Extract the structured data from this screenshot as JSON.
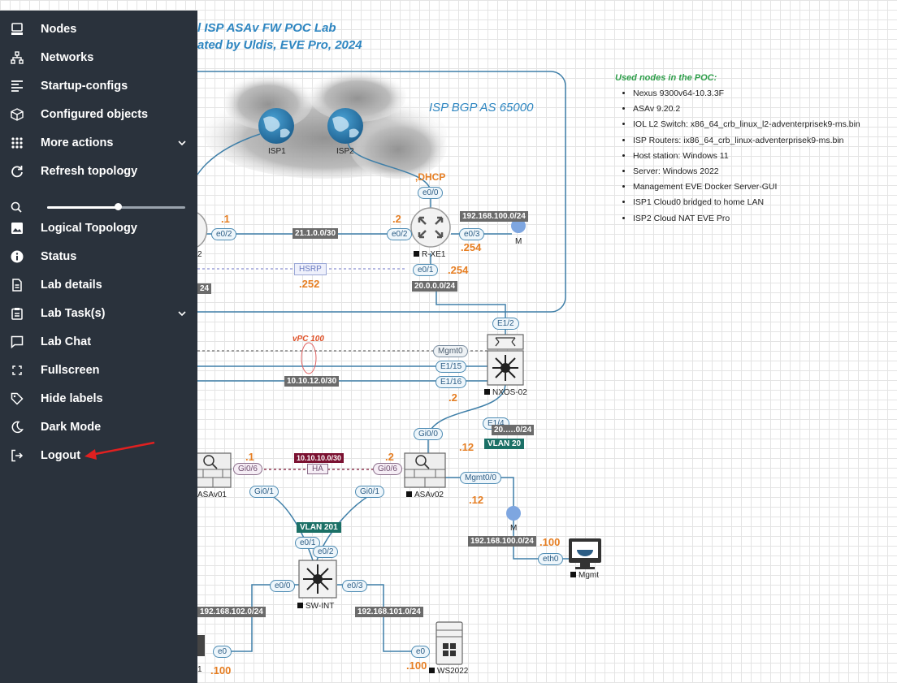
{
  "sidebar": {
    "items": [
      {
        "label": "Nodes",
        "icon": "nodes-icon"
      },
      {
        "label": "Networks",
        "icon": "networks-icon"
      },
      {
        "label": "Startup-configs",
        "icon": "startup-configs-icon"
      },
      {
        "label": "Configured objects",
        "icon": "configured-objects-icon"
      },
      {
        "label": "More actions",
        "icon": "more-actions-icon"
      },
      {
        "label": "Refresh topology",
        "icon": "refresh-icon"
      },
      {
        "label": "Logical Topology",
        "icon": "image-icon"
      },
      {
        "label": "Status",
        "icon": "info-icon"
      },
      {
        "label": "Lab details",
        "icon": "document-icon"
      },
      {
        "label": "Lab Task(s)",
        "icon": "clipboard-icon"
      },
      {
        "label": "Lab Chat",
        "icon": "chat-icon"
      },
      {
        "label": "Fullscreen",
        "icon": "fullscreen-icon"
      },
      {
        "label": "Hide labels",
        "icon": "tag-icon"
      },
      {
        "label": "Dark Mode",
        "icon": "moon-icon"
      },
      {
        "label": "Logout",
        "icon": "logout-icon"
      }
    ],
    "zoom_level": 0.51,
    "colors": {
      "background": "#2a323c",
      "text": "#ffffff",
      "annotation_arrow": "#e02020"
    }
  },
  "topology": {
    "title_line1": "l ISP ASAv FW POC Lab",
    "title_line2": "ated by Uldis, EVE Pro, 2024",
    "isp_box_title": "ISP BGP AS 65000",
    "nodes": {
      "isp1": "ISP1",
      "isp2": "ISP2",
      "r_xe1": "R-XE1",
      "r_left_partial": "2",
      "mgmt_cloud_top": "M",
      "nxos02": "NXOS-02",
      "asav01": "ASAv01",
      "asav02": "ASAv02",
      "mgmt_cloud_bottom": "M",
      "mgmt": "Mgmt",
      "sw_int": "SW-INT",
      "ws2022": "WS2022",
      "w_left_partial": "1"
    },
    "ifaces": {
      "e0_0_top": "e0/0",
      "e0_2_left": "e0/2",
      "e0_2_right": "e0/2",
      "e0_3_rxe1": "e0/3",
      "e0_1_rxe1": "e0/1",
      "e1_2": "E1/2",
      "mgmt0": "Mgmt0",
      "e1_15": "E1/15",
      "e1_16": "E1/16",
      "e1_4": "E1/4",
      "gi0_0": "Gi0/0",
      "gi0_6_left": "Gi0/6",
      "gi0_6_right": "Gi0/6",
      "mgmt0_0": "Mgmt0/0",
      "gi0_1_left": "Gi0/1",
      "gi0_1_right": "Gi0/1",
      "e0_1_sw": "e0/1",
      "e0_2_sw": "e0/2",
      "e0_0_sw": "e0/0",
      "e0_3_sw": "e0/3",
      "e0_ws": "e0",
      "e0_left": "e0",
      "eth0": "eth0"
    },
    "networks": {
      "net_21": "21.1.0.0/30",
      "net_192_100_top": "192.168.100.0/24",
      "net_20": "20.0.0.0/24",
      "net_24_partial": "24",
      "net_10_12": "10.10.12.0/30",
      "net_20_partial": "20.….0/24",
      "vlan20": "VLAN 20",
      "net_10_10": "10.10.10.0/30",
      "vlan201": "VLAN 201",
      "net_192_100_bottom": "192.168.100.0/24",
      "net_192_102": "192.168.102.0/24",
      "net_192_101": "192.168.101.0/24"
    },
    "ip_labels": {
      "dot1_top": ".1",
      "dot2_top": ".2",
      "dot254_a": ".254",
      "dot254_b": ".254",
      "dot252": ".252",
      "dot2_nx": ".2",
      "dot12_a": ".12",
      "dot1_asa": ".1",
      "dot2_asa": ".2",
      "dot12_b": ".12",
      "dot100_mgmt": ".100",
      "dot100_ws": ".100",
      "dot100_left": ".100"
    },
    "dhcp": ",DHCP",
    "hsrp": "HSRP",
    "ha": "HA",
    "vpc": "vPC 100",
    "colors": {
      "link": "#3f7fa8",
      "accent_blue": "#2e86c1",
      "orange": "#e67e22",
      "vlan": "#1b7066"
    }
  },
  "notes": {
    "heading": "Used nodes in the POC:",
    "items": [
      "Nexus 9300v64-10.3.3F",
      "ASAv 9.20.2",
      "IOL L2 Switch: x86_64_crb_linux_l2-adventerprisek9-ms.bin",
      "ISP Routers: ix86_64_crb_linux-adventerprisek9-ms.bin",
      "Host station: Windows 11",
      "Server: Windows 2022",
      "Management EVE Docker Server-GUI",
      "ISP1 Cloud0 bridged to home LAN",
      "ISP2 Cloud NAT EVE Pro"
    ]
  }
}
